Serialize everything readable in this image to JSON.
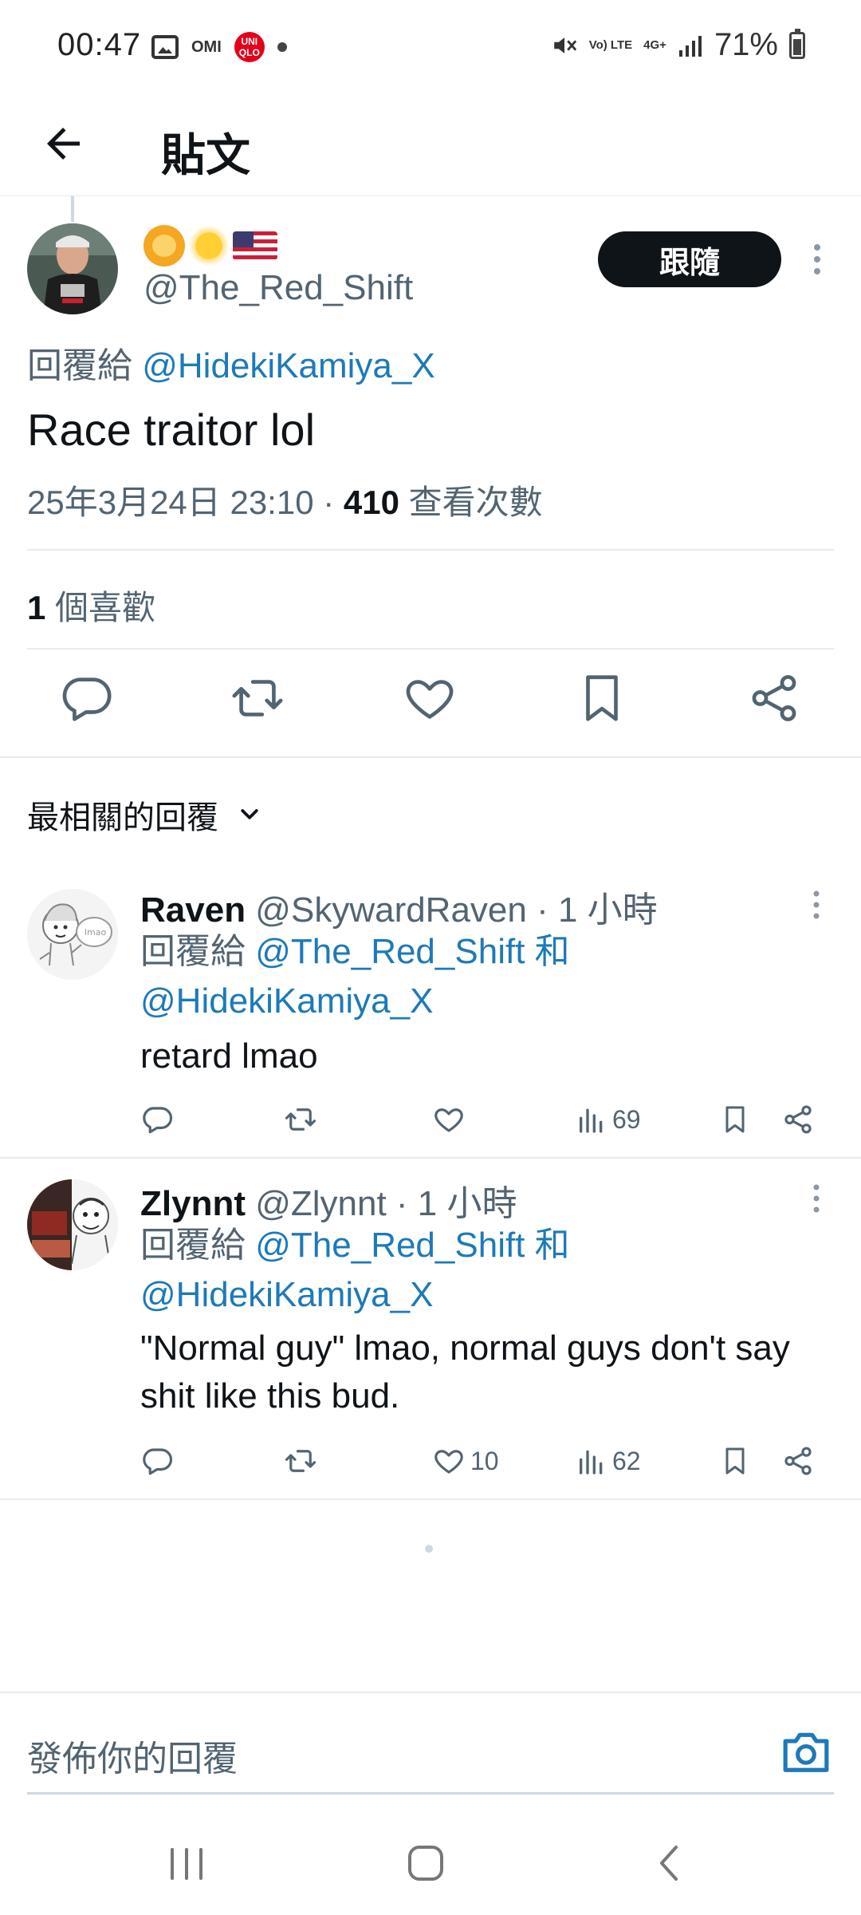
{
  "status_bar": {
    "time": "00:47",
    "omi": "OMI",
    "uniqlo": "UNI QLO",
    "volte": "Vo) LTE",
    "network": "4G+",
    "battery": "71%"
  },
  "header": {
    "title": "貼文"
  },
  "main_tweet": {
    "emojis": [
      "lion-face-emoji",
      "sun-emoji",
      "us-flag-emoji"
    ],
    "handle": "@The_Red_Shift",
    "follow_label": "跟隨",
    "reply_prefix": "回覆給 ",
    "reply_to": "@HidekiKamiya_X",
    "text": "Race traitor lol",
    "timestamp": "25年3月24日 23:10 · ",
    "views": "410",
    "views_label": " 查看次數",
    "likes": "1",
    "likes_label": " 個喜歡",
    "actions": [
      "reply-icon",
      "retweet-icon",
      "like-icon",
      "bookmark-icon",
      "share-icon"
    ]
  },
  "sort": {
    "label": "最相關的回覆"
  },
  "replies": [
    {
      "name": "Raven",
      "handle": " @SkywardRaven",
      "time": " · 1 小時",
      "reply_prefix": "回覆給 ",
      "reply_to_1": "@The_Red_Shift",
      "reply_and": " 和",
      "reply_to_2": "@HidekiKamiya_X",
      "text": "retard lmao",
      "likes": "",
      "views": "69"
    },
    {
      "name": "Zlynnt",
      "handle": " @Zlynnt",
      "time": " · 1 小時",
      "reply_prefix": "回覆給 ",
      "reply_to_1": "@The_Red_Shift",
      "reply_and": " 和",
      "reply_to_2": "@HidekiKamiya_X",
      "text": "\"Normal guy\" lmao, normal guys don't say shit like this bud.",
      "likes": "10",
      "views": "62"
    }
  ],
  "compose": {
    "placeholder": "發佈你的回覆"
  },
  "colors": {
    "accent": "#1d9bf0",
    "text": "#0f1419",
    "muted": "#536471",
    "follow_bg": "#0f1419"
  }
}
